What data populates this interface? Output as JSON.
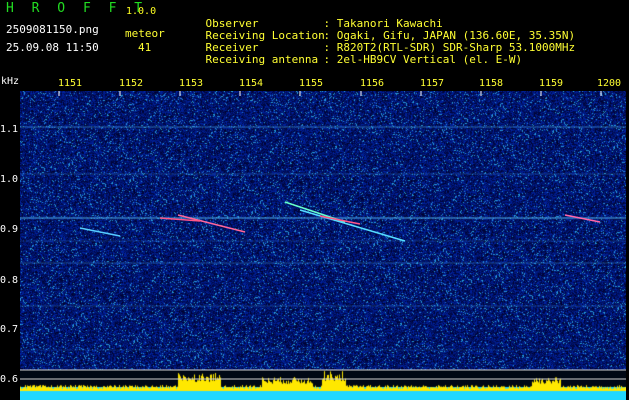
{
  "header": {
    "app_title": "H R O F F T",
    "version": "1.0.0",
    "filename": "2509081150.png",
    "timestamp": "25.09.08 11:50",
    "meteor_label": "meteor",
    "meteor_count": "41"
  },
  "info": [
    {
      "label": "Observer",
      "value": ": Takanori Kawachi"
    },
    {
      "label": "Receiving Location",
      "value": ": Ogaki, Gifu, JAPAN (136.60E, 35.35N)"
    },
    {
      "label": "Receiver",
      "value": ": R820T2(RTL-SDR) SDR-Sharp 53.1000MHz"
    },
    {
      "label": "Receiving antenna",
      "value": ": 2el-HB9CV Vertical (el. E-W)"
    }
  ],
  "chart_data": {
    "type": "heatmap",
    "y_unit": "kHz",
    "y_ticks": [
      "1.1",
      "1.0",
      "0.9",
      "0.8",
      "0.7",
      "0.6"
    ],
    "x_ticks": [
      "1151",
      "1152",
      "1153",
      "1154",
      "1155",
      "1156",
      "1157",
      "1158",
      "1159",
      "1200"
    ],
    "ylim": [
      0.58,
      1.18
    ],
    "xlim": [
      "11:50",
      "12:00"
    ]
  },
  "colors": {
    "background": "#000000",
    "noise_base": "#0a1a8a",
    "carrier": "#55ccff",
    "activity_bar": "#ffee00",
    "baseline": "#22ddff"
  }
}
